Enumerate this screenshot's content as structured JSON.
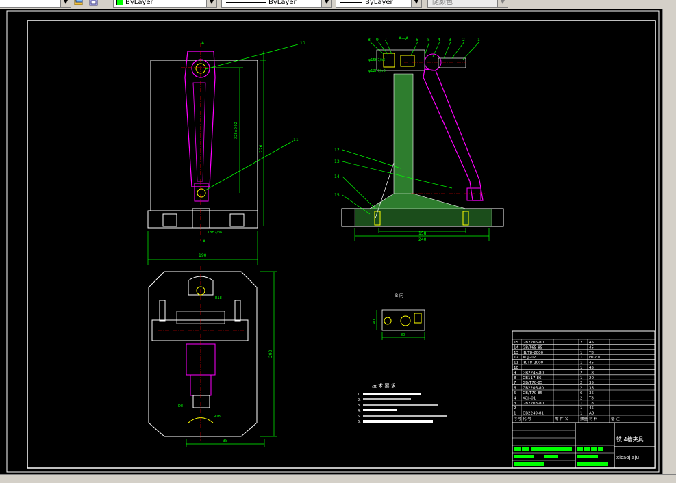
{
  "toolbar": {
    "color_control": "ByLayer",
    "linetype_control": "ByLayer",
    "lineweight_control": "ByLayer",
    "plotstyle_control": "随颜色"
  },
  "drawing": {
    "section_mark": "A",
    "section_view_title": "A—A",
    "detail_view_title": "B 向",
    "callouts_front": [
      "10",
      "11"
    ],
    "callouts_side_top": [
      "8",
      "9",
      "7",
      "6",
      "5",
      "4",
      "3",
      "2",
      "1"
    ],
    "callouts_side_left": [
      "12",
      "13",
      "14",
      "15"
    ],
    "dims": {
      "front_width": "190",
      "front_height": "226",
      "front_inner": "228±0.02",
      "front_fit": "18H7/n6",
      "side_inner": "158",
      "side_total": "240",
      "side_fit1": "φ15H7/k6",
      "side_fit2": "φ12H7/n6",
      "plan_height": "290",
      "plan_width": "35",
      "plan_r_top": "R18",
      "plan_r_bot": "R18",
      "plan_d": "D8",
      "detail_w": "80",
      "detail_h": "40"
    },
    "tech_req_title": "技 术 要 求",
    "tech_req_lines": [
      "1.",
      "2.",
      "3.",
      "4.",
      "5.",
      "6."
    ],
    "bom_rows": [
      {
        "no": "15",
        "code": "GB2206-80",
        "name": "",
        "qty": "2",
        "mat": "45"
      },
      {
        "no": "14",
        "code": "GB/T65-85",
        "name": "",
        "qty": "",
        "mat": "45"
      },
      {
        "no": "13",
        "code": "JB/T8-2000",
        "name": "",
        "qty": "1",
        "mat": "T8"
      },
      {
        "no": "12",
        "code": "XCJJ-02",
        "name": "",
        "qty": "1",
        "mat": "HT200"
      },
      {
        "no": "11",
        "code": "JB/T8-2000",
        "name": "",
        "qty": "1",
        "mat": "45"
      },
      {
        "no": "10",
        "code": "",
        "name": "",
        "qty": "1",
        "mat": "45"
      },
      {
        "no": "9",
        "code": "GB2245-80",
        "name": "",
        "qty": "2",
        "mat": "T8"
      },
      {
        "no": "8",
        "code": "GB117-86",
        "name": "",
        "qty": "1",
        "mat": "20"
      },
      {
        "no": "7",
        "code": "GB/T70-85",
        "name": "",
        "qty": "2",
        "mat": "35"
      },
      {
        "no": "6",
        "code": "GB2206-80",
        "name": "",
        "qty": "2",
        "mat": "35"
      },
      {
        "no": "5",
        "code": "GB/T70-85",
        "name": "",
        "qty": "6",
        "mat": "35"
      },
      {
        "no": "4",
        "code": "XCJJ-01",
        "name": "",
        "qty": "2",
        "mat": "T8"
      },
      {
        "no": "3",
        "code": "GB2203-80",
        "name": "",
        "qty": "1",
        "mat": "T8"
      },
      {
        "no": "2",
        "code": "",
        "name": "",
        "qty": "1",
        "mat": "45"
      },
      {
        "no": "1",
        "code": "GB2249-81",
        "name": "",
        "qty": "1",
        "mat": "A3"
      }
    ],
    "bom_header": {
      "no": "序号",
      "code": "代 号",
      "name": "零 件 名",
      "qty": "数量",
      "mat": "材 料",
      "note": "备 注"
    },
    "title_block": {
      "title": "铣 4槽夹具",
      "code": "xicaojiaju"
    }
  }
}
